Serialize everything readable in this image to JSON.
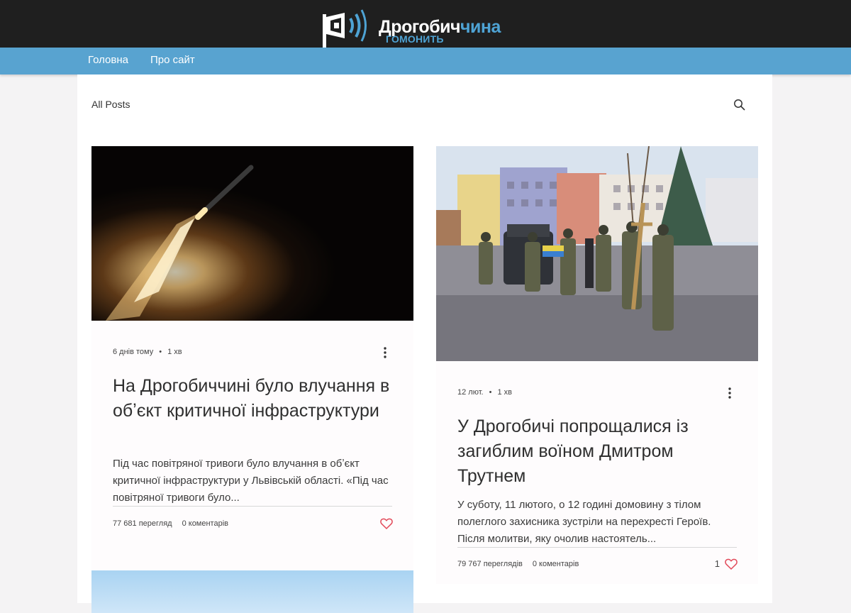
{
  "colors": {
    "header_bg": "#1f1f1f",
    "nav_bg": "#58a3d0",
    "brand_blue": "#4ea3d4",
    "like_red": "#e24a5a"
  },
  "logo": {
    "title_part1": "Дрогобич",
    "title_part2": "чина",
    "subtitle": "ГОМОНИТЬ"
  },
  "nav": {
    "items": [
      {
        "label": "Головна"
      },
      {
        "label": "Про сайт"
      }
    ]
  },
  "blog": {
    "all_posts_label": "All Posts",
    "search_icon": "search-icon"
  },
  "posts": [
    {
      "date": "6 днів тому",
      "read_time": "1 хв",
      "title": "На Дрогобиччині було влучання в обʼєкт критичної інфраструктури",
      "excerpt": "Під час повітряної тривоги було влучання в обʼєкт критичної інфраструктури у Львівській області. «Під час повітряної тривоги було...",
      "views": "77 681 перегляд",
      "comments": "0 коментарів",
      "likes": ""
    },
    {
      "date": "12 лют.",
      "read_time": "1 хв",
      "title": "У Дрогобичі попрощалися із загиблим воїном Дмитром Трутнем",
      "excerpt": "У суботу, 11 лютого, о 12 годині домовину з тілом полеглого захисника зустріли на перехресті Героїв. Після молитви, яку очолив настоятель...",
      "views": "79 767 переглядів",
      "comments": "0 коментарів",
      "likes": "1"
    }
  ]
}
